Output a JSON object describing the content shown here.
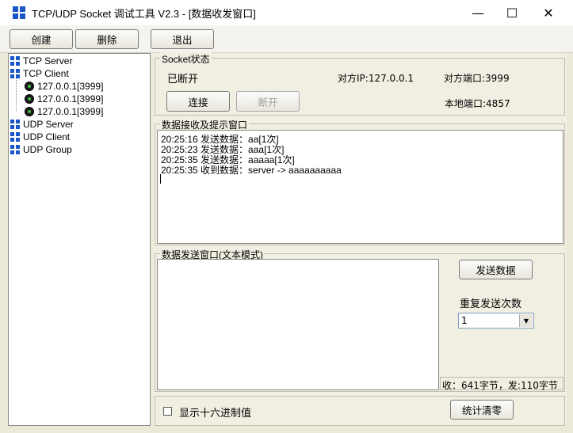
{
  "window": {
    "title": "TCP/UDP Socket 调试工具 V2.3 - [数据收发窗口]",
    "minimize": "—",
    "maximize": "☐",
    "close": "✕"
  },
  "toolbar": {
    "create": "创建",
    "delete": "删除",
    "exit": "退出"
  },
  "tree": {
    "tcp_server": "TCP Server",
    "tcp_client": "TCP Client",
    "clients": [
      "127.0.0.1[3999]",
      "127.0.0.1[3999]",
      "127.0.0.1[3999]"
    ],
    "udp_server": "UDP Server",
    "udp_client": "UDP Client",
    "udp_group": "UDP Group"
  },
  "socket": {
    "group_title": "Socket状态",
    "status": "已断开",
    "peer_ip": "对方IP:127.0.0.1",
    "peer_port": "对方端口:3999",
    "local_port": "本地端口:4857",
    "connect": "连接",
    "disconnect": "断开"
  },
  "receive": {
    "group_title": "数据接收及提示窗口",
    "lines": [
      "20:25:16 发送数据：aa[1次]",
      "20:25:23 发送数据：aaa[1次]",
      "20:25:35 发送数据：aaaaa[1次]",
      "20:25:35 收到数据：server -> aaaaaaaaaa"
    ]
  },
  "send": {
    "group_title": "数据发送窗口(文本模式)",
    "send_button": "发送数据",
    "repeat_label": "重复发送次数",
    "repeat_value": "1",
    "stats": "收：641字节，发:110字节"
  },
  "footer": {
    "hex_label": "显示十六进制值",
    "reset_stats": "统计清零"
  },
  "colors": {
    "window_bg": "#ece9d8",
    "panel_bg": "#f1efe2",
    "icon_blue": "#1a56c8"
  }
}
